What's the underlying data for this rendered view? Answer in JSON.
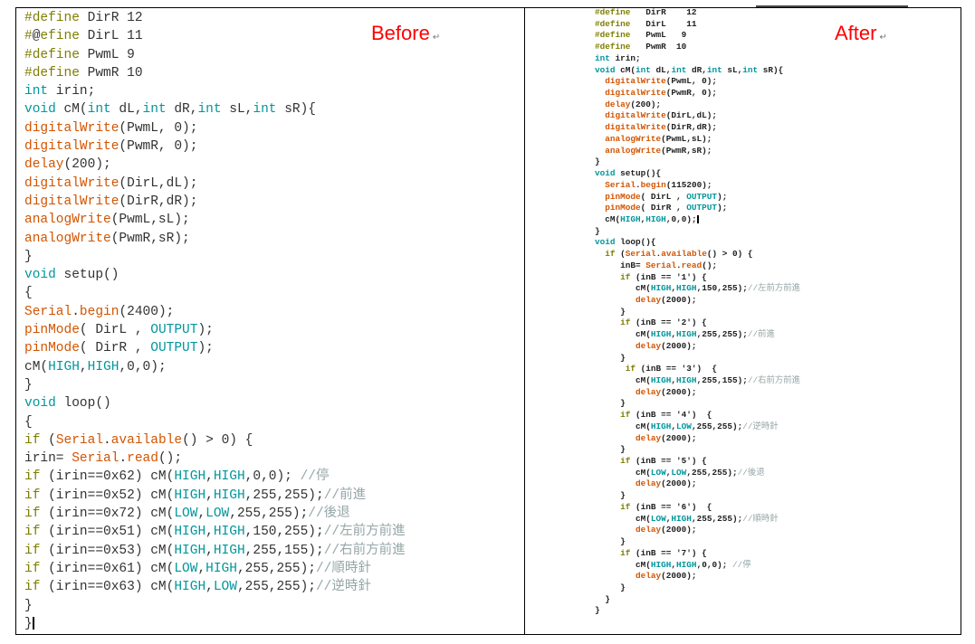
{
  "labels": {
    "before": "Before",
    "after": "After",
    "return_mark": "↵"
  },
  "colors": {
    "keyword": "#7e7e00",
    "type_constant": "#00979c",
    "function": "#d35400",
    "comment": "#95a5a6",
    "label": "#ff0000"
  },
  "before": {
    "lines": [
      [
        [
          "k",
          "#define"
        ],
        [
          "p",
          " DirR 12"
        ]
      ],
      [
        [
          "k",
          "#"
        ],
        [
          "p",
          "@"
        ],
        [
          "k",
          "efine"
        ],
        [
          "p",
          " DirL 11"
        ]
      ],
      [
        [
          "k",
          "#define"
        ],
        [
          "p",
          " PwmL 9"
        ]
      ],
      [
        [
          "k",
          "#define"
        ],
        [
          "p",
          " PwmR 10"
        ]
      ],
      [
        [
          "t",
          "int"
        ],
        [
          "p",
          " irin;"
        ]
      ],
      [
        [
          "t",
          "void"
        ],
        [
          "p",
          " cM("
        ],
        [
          "t",
          "int"
        ],
        [
          "p",
          " dL,"
        ],
        [
          "t",
          "int"
        ],
        [
          "p",
          " dR,"
        ],
        [
          "t",
          "int"
        ],
        [
          "p",
          " sL,"
        ],
        [
          "t",
          "int"
        ],
        [
          "p",
          " sR){"
        ]
      ],
      [
        [
          "f",
          "digitalWrite"
        ],
        [
          "p",
          "(PwmL, 0);"
        ]
      ],
      [
        [
          "f",
          "digitalWrite"
        ],
        [
          "p",
          "(PwmR, 0);"
        ]
      ],
      [
        [
          "f",
          "delay"
        ],
        [
          "p",
          "(200);"
        ]
      ],
      [
        [
          "f",
          "digitalWrite"
        ],
        [
          "p",
          "(DirL,dL);"
        ]
      ],
      [
        [
          "f",
          "digitalWrite"
        ],
        [
          "p",
          "(DirR,dR);"
        ]
      ],
      [
        [
          "f",
          "analogWrite"
        ],
        [
          "p",
          "(PwmL,sL);"
        ]
      ],
      [
        [
          "f",
          "analogWrite"
        ],
        [
          "p",
          "(PwmR,sR);"
        ]
      ],
      [
        [
          "p",
          "}"
        ]
      ],
      [
        [
          "t",
          "void"
        ],
        [
          "p",
          " setup()"
        ]
      ],
      [
        [
          "p",
          "{"
        ]
      ],
      [
        [
          "f",
          "Serial"
        ],
        [
          "p",
          "."
        ],
        [
          "f",
          "begin"
        ],
        [
          "p",
          "(2400);"
        ]
      ],
      [
        [
          "f",
          "pinMode"
        ],
        [
          "p",
          "( DirL , "
        ],
        [
          "t",
          "OUTPUT"
        ],
        [
          "p",
          ");"
        ]
      ],
      [
        [
          "f",
          "pinMode"
        ],
        [
          "p",
          "( DirR , "
        ],
        [
          "t",
          "OUTPUT"
        ],
        [
          "p",
          ");"
        ]
      ],
      [
        [
          "p",
          "cM("
        ],
        [
          "t",
          "HIGH"
        ],
        [
          "p",
          ","
        ],
        [
          "t",
          "HIGH"
        ],
        [
          "p",
          ",0,0);"
        ]
      ],
      [
        [
          "p",
          "}"
        ]
      ],
      [
        [
          "t",
          "void"
        ],
        [
          "p",
          " loop()"
        ]
      ],
      [
        [
          "p",
          "{"
        ]
      ],
      [
        [
          "k",
          "if"
        ],
        [
          "p",
          " ("
        ],
        [
          "f",
          "Serial"
        ],
        [
          "p",
          "."
        ],
        [
          "f",
          "available"
        ],
        [
          "p",
          "() > 0) {"
        ]
      ],
      [
        [
          "p",
          "irin= "
        ],
        [
          "f",
          "Serial"
        ],
        [
          "p",
          "."
        ],
        [
          "f",
          "read"
        ],
        [
          "p",
          "();"
        ]
      ],
      [
        [
          "k",
          "if"
        ],
        [
          "p",
          " (irin==0x62) cM("
        ],
        [
          "t",
          "HIGH"
        ],
        [
          "p",
          ","
        ],
        [
          "t",
          "HIGH"
        ],
        [
          "p",
          ",0,0); "
        ],
        [
          "c",
          "//停"
        ]
      ],
      [
        [
          "k",
          "if"
        ],
        [
          "p",
          " (irin==0x52) cM("
        ],
        [
          "t",
          "HIGH"
        ],
        [
          "p",
          ","
        ],
        [
          "t",
          "HIGH"
        ],
        [
          "p",
          ",255,255);"
        ],
        [
          "c",
          "//前進"
        ]
      ],
      [
        [
          "k",
          "if"
        ],
        [
          "p",
          " (irin==0x72) cM("
        ],
        [
          "t",
          "LOW"
        ],
        [
          "p",
          ","
        ],
        [
          "t",
          "LOW"
        ],
        [
          "p",
          ",255,255);"
        ],
        [
          "c",
          "//後退"
        ]
      ],
      [
        [
          "k",
          "if"
        ],
        [
          "p",
          " (irin==0x51) cM("
        ],
        [
          "t",
          "HIGH"
        ],
        [
          "p",
          ","
        ],
        [
          "t",
          "HIGH"
        ],
        [
          "p",
          ",150,255);"
        ],
        [
          "c",
          "//左前方前進"
        ]
      ],
      [
        [
          "k",
          "if"
        ],
        [
          "p",
          " (irin==0x53) cM("
        ],
        [
          "t",
          "HIGH"
        ],
        [
          "p",
          ","
        ],
        [
          "t",
          "HIGH"
        ],
        [
          "p",
          ",255,155);"
        ],
        [
          "c",
          "//右前方前進"
        ]
      ],
      [
        [
          "k",
          "if"
        ],
        [
          "p",
          " (irin==0x61) cM("
        ],
        [
          "t",
          "LOW"
        ],
        [
          "p",
          ","
        ],
        [
          "t",
          "HIGH"
        ],
        [
          "p",
          ",255,255);"
        ],
        [
          "c",
          "//順時針"
        ]
      ],
      [
        [
          "k",
          "if"
        ],
        [
          "p",
          " (irin==0x63) cM("
        ],
        [
          "t",
          "HIGH"
        ],
        [
          "p",
          ","
        ],
        [
          "t",
          "LOW"
        ],
        [
          "p",
          ",255,255);"
        ],
        [
          "c",
          "//逆時針"
        ]
      ],
      [
        [
          "p",
          "}"
        ]
      ],
      [
        [
          "p",
          "}"
        ]
      ]
    ]
  },
  "after": {
    "lines": [
      [
        [
          "k",
          "#define"
        ],
        [
          "p",
          "   DirR    12"
        ]
      ],
      [
        [
          "k",
          "#define"
        ],
        [
          "p",
          "   DirL    11"
        ]
      ],
      [
        [
          "k",
          "#define"
        ],
        [
          "p",
          "   PwmL   9"
        ]
      ],
      [
        [
          "k",
          "#define"
        ],
        [
          "p",
          "   PwmR  10"
        ]
      ],
      [
        [
          "t",
          "int"
        ],
        [
          "p",
          " irin;"
        ]
      ],
      [
        [
          "t",
          "void"
        ],
        [
          "p",
          " cM("
        ],
        [
          "t",
          "int"
        ],
        [
          "p",
          " dL,"
        ],
        [
          "t",
          "int"
        ],
        [
          "p",
          " dR,"
        ],
        [
          "t",
          "int"
        ],
        [
          "p",
          " sL,"
        ],
        [
          "t",
          "int"
        ],
        [
          "p",
          " sR){"
        ]
      ],
      [
        [
          "p",
          "  "
        ],
        [
          "f",
          "digitalWrite"
        ],
        [
          "p",
          "(PwmL, 0);"
        ]
      ],
      [
        [
          "p",
          "  "
        ],
        [
          "f",
          "digitalWrite"
        ],
        [
          "p",
          "(PwmR, 0);"
        ]
      ],
      [
        [
          "p",
          "  "
        ],
        [
          "f",
          "delay"
        ],
        [
          "p",
          "(200);"
        ]
      ],
      [
        [
          "p",
          "  "
        ],
        [
          "f",
          "digitalWrite"
        ],
        [
          "p",
          "(DirL,dL);"
        ]
      ],
      [
        [
          "p",
          "  "
        ],
        [
          "f",
          "digitalWrite"
        ],
        [
          "p",
          "(DirR,dR);"
        ]
      ],
      [
        [
          "p",
          "  "
        ],
        [
          "f",
          "analogWrite"
        ],
        [
          "p",
          "(PwmL,sL);"
        ]
      ],
      [
        [
          "p",
          "  "
        ],
        [
          "f",
          "analogWrite"
        ],
        [
          "p",
          "(PwmR,sR);"
        ]
      ],
      [
        [
          "p",
          "}"
        ]
      ],
      [
        [
          "t",
          "void"
        ],
        [
          "p",
          " setup(){"
        ]
      ],
      [
        [
          "p",
          "  "
        ],
        [
          "f",
          "Serial"
        ],
        [
          "p",
          "."
        ],
        [
          "f",
          "begin"
        ],
        [
          "p",
          "(115200);"
        ]
      ],
      [
        [
          "p",
          "  "
        ],
        [
          "f",
          "pinMode"
        ],
        [
          "p",
          "( DirL , "
        ],
        [
          "t",
          "OUTPUT"
        ],
        [
          "p",
          ");"
        ]
      ],
      [
        [
          "p",
          "  "
        ],
        [
          "f",
          "pinMode"
        ],
        [
          "p",
          "( DirR , "
        ],
        [
          "t",
          "OUTPUT"
        ],
        [
          "p",
          ");"
        ]
      ],
      [
        [
          "p",
          "  cM("
        ],
        [
          "t",
          "HIGH"
        ],
        [
          "p",
          ","
        ],
        [
          "t",
          "HIGH"
        ],
        [
          "p",
          ",0,0);"
        ]
      ],
      [
        [
          "p",
          "}"
        ]
      ],
      [
        [
          "t",
          "void"
        ],
        [
          "p",
          " loop(){"
        ]
      ],
      [
        [
          "p",
          "  "
        ],
        [
          "k",
          "if"
        ],
        [
          "p",
          " ("
        ],
        [
          "f",
          "Serial"
        ],
        [
          "p",
          "."
        ],
        [
          "f",
          "available"
        ],
        [
          "p",
          "() > 0) {"
        ]
      ],
      [
        [
          "p",
          "     inB= "
        ],
        [
          "f",
          "Serial"
        ],
        [
          "p",
          "."
        ],
        [
          "f",
          "read"
        ],
        [
          "p",
          "();"
        ]
      ],
      [
        [
          "p",
          "     "
        ],
        [
          "k",
          "if"
        ],
        [
          "p",
          " (inB == '1') {"
        ]
      ],
      [
        [
          "p",
          "        cM("
        ],
        [
          "t",
          "HIGH"
        ],
        [
          "p",
          ","
        ],
        [
          "t",
          "HIGH"
        ],
        [
          "p",
          ",150,255);"
        ],
        [
          "c",
          "//左前方前進"
        ]
      ],
      [
        [
          "p",
          "        "
        ],
        [
          "f",
          "delay"
        ],
        [
          "p",
          "(2000);"
        ]
      ],
      [
        [
          "p",
          "     }"
        ]
      ],
      [
        [
          "p",
          "     "
        ],
        [
          "k",
          "if"
        ],
        [
          "p",
          " (inB == '2') {"
        ]
      ],
      [
        [
          "p",
          "        cM("
        ],
        [
          "t",
          "HIGH"
        ],
        [
          "p",
          ","
        ],
        [
          "t",
          "HIGH"
        ],
        [
          "p",
          ",255,255);"
        ],
        [
          "c",
          "//前進"
        ]
      ],
      [
        [
          "p",
          "        "
        ],
        [
          "f",
          "delay"
        ],
        [
          "p",
          "(2000);"
        ]
      ],
      [
        [
          "p",
          "     }"
        ]
      ],
      [
        [
          "p",
          "      "
        ],
        [
          "k",
          "if"
        ],
        [
          "p",
          " (inB == '3')  {"
        ]
      ],
      [
        [
          "p",
          "        cM("
        ],
        [
          "t",
          "HIGH"
        ],
        [
          "p",
          ","
        ],
        [
          "t",
          "HIGH"
        ],
        [
          "p",
          ",255,155);"
        ],
        [
          "c",
          "//右前方前進"
        ]
      ],
      [
        [
          "p",
          "        "
        ],
        [
          "f",
          "delay"
        ],
        [
          "p",
          "(2000);"
        ]
      ],
      [
        [
          "p",
          "     }"
        ]
      ],
      [
        [
          "p",
          "     "
        ],
        [
          "k",
          "if"
        ],
        [
          "p",
          " (inB == '4')  {"
        ]
      ],
      [
        [
          "p",
          "        cM("
        ],
        [
          "t",
          "HIGH"
        ],
        [
          "p",
          ","
        ],
        [
          "t",
          "LOW"
        ],
        [
          "p",
          ",255,255);"
        ],
        [
          "c",
          "//逆時針"
        ]
      ],
      [
        [
          "p",
          "        "
        ],
        [
          "f",
          "delay"
        ],
        [
          "p",
          "(2000);"
        ]
      ],
      [
        [
          "p",
          "     }"
        ]
      ],
      [
        [
          "p",
          "     "
        ],
        [
          "k",
          "if"
        ],
        [
          "p",
          " (inB == '5') {"
        ]
      ],
      [
        [
          "p",
          "        cM("
        ],
        [
          "t",
          "LOW"
        ],
        [
          "p",
          ","
        ],
        [
          "t",
          "LOW"
        ],
        [
          "p",
          ",255,255);"
        ],
        [
          "c",
          "//後退"
        ]
      ],
      [
        [
          "p",
          "        "
        ],
        [
          "f",
          "delay"
        ],
        [
          "p",
          "(2000);"
        ]
      ],
      [
        [
          "p",
          "     }"
        ]
      ],
      [
        [
          "p",
          "     "
        ],
        [
          "k",
          "if"
        ],
        [
          "p",
          " (inB == '6')  {"
        ]
      ],
      [
        [
          "p",
          "        cM("
        ],
        [
          "t",
          "LOW"
        ],
        [
          "p",
          ","
        ],
        [
          "t",
          "HIGH"
        ],
        [
          "p",
          ",255,255);"
        ],
        [
          "c",
          "//順時針"
        ]
      ],
      [
        [
          "p",
          "        "
        ],
        [
          "f",
          "delay"
        ],
        [
          "p",
          "(2000);"
        ]
      ],
      [
        [
          "p",
          "     }"
        ]
      ],
      [
        [
          "p",
          "     "
        ],
        [
          "k",
          "if"
        ],
        [
          "p",
          " (inB == '7') {"
        ]
      ],
      [
        [
          "p",
          "        cM("
        ],
        [
          "t",
          "HIGH"
        ],
        [
          "p",
          ","
        ],
        [
          "t",
          "HIGH"
        ],
        [
          "p",
          ",0,0); "
        ],
        [
          "c",
          "//停"
        ]
      ],
      [
        [
          "p",
          "        "
        ],
        [
          "f",
          "delay"
        ],
        [
          "p",
          "(2000);"
        ]
      ],
      [
        [
          "p",
          "     }"
        ]
      ],
      [
        [
          "p",
          "  }"
        ]
      ],
      [
        [
          "p",
          "}"
        ]
      ]
    ]
  }
}
